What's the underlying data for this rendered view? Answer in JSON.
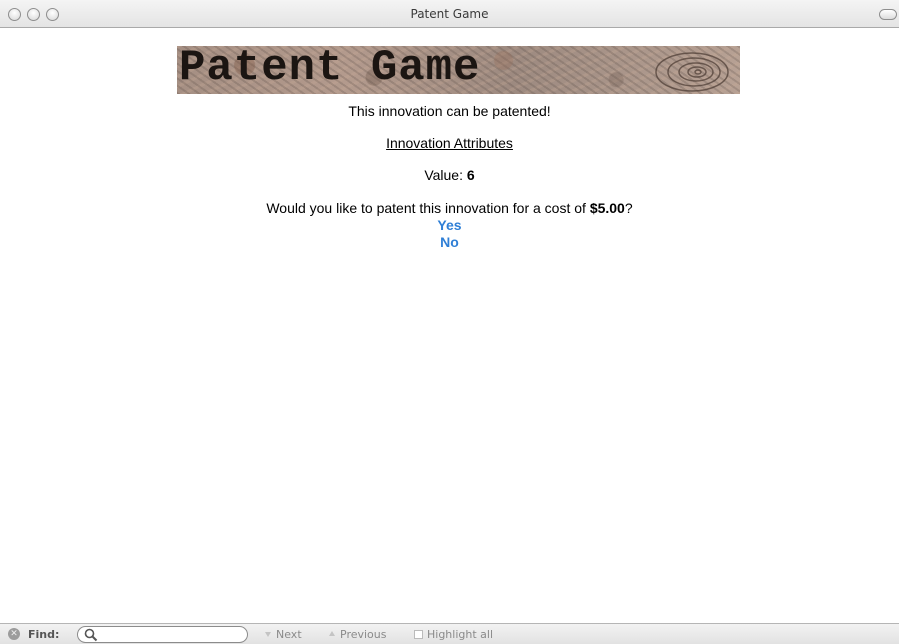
{
  "window": {
    "title": "Patent Game"
  },
  "banner": {
    "title": "Patent Game"
  },
  "content": {
    "status_message": "This innovation can be patented!",
    "attributes_heading": "Innovation Attributes",
    "value_label": "Value: ",
    "value": "6",
    "question_prefix": "Would you like to patent this innovation for a cost of ",
    "cost": "$5.00",
    "question_suffix": "?",
    "yes_label": "Yes",
    "no_label": "No"
  },
  "findbar": {
    "label": "Find:",
    "search_value": "",
    "next_label": "Next",
    "previous_label": "Previous",
    "highlight_label": "Highlight all"
  },
  "colors": {
    "link": "#2f7fd6"
  }
}
